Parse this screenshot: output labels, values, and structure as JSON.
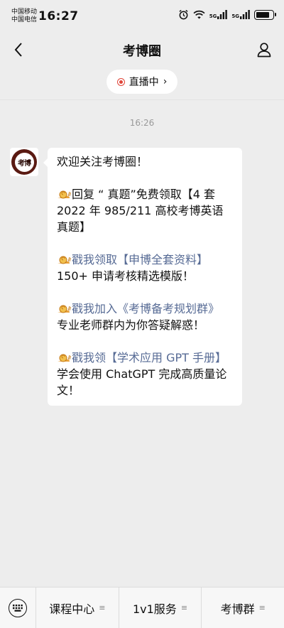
{
  "status_bar": {
    "carrier_1": "中国移动",
    "carrier_2": "中国电信",
    "time": "16:27",
    "net_1": "5G",
    "net_2": "5G",
    "icons": [
      "alarm-icon",
      "wifi-icon",
      "signal-icon",
      "signal-icon",
      "battery-icon"
    ],
    "battery_level": 0.85
  },
  "navbar": {
    "title": "考博圈",
    "back_icon": "chevron-left-icon",
    "profile_icon": "person-icon"
  },
  "live": {
    "label": "直播中",
    "chevron": "›"
  },
  "chat": {
    "timestamp": "16:26",
    "avatar_text": "考博",
    "message": {
      "greeting": "欢迎关注考博圈！",
      "item1_prefix": "回复 “ 真题”免费领取【4 套 2022 年 985/211 高校考博英语真题】",
      "item2_link": "戳我领取【申博全套资料】",
      "item2_text": "150+ 申请考核精选模版！",
      "item3_link": "戳我加入《考博备考规划群》",
      "item3_text": "专业老师群内为你答疑解惑！",
      "item4_link": "戳我领【学术应用 GPT 手册】",
      "item4_text": " 学会使用 ChatGPT 完成高质量论文！"
    },
    "link_color": "#576b95"
  },
  "bottom_menu": {
    "keyboard_icon": "keyboard-icon",
    "items": [
      {
        "label": "课程中心",
        "glyph": "≡"
      },
      {
        "label": "1v1服务",
        "glyph": "≡"
      },
      {
        "label": "考博群",
        "glyph": "≡"
      }
    ]
  }
}
